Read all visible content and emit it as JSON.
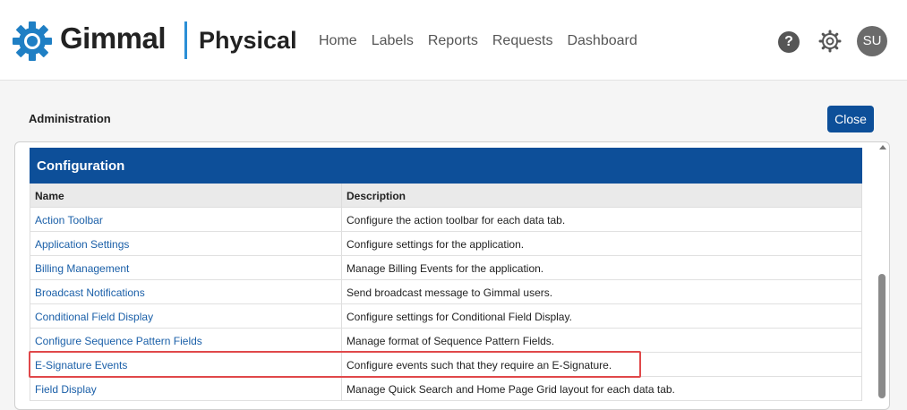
{
  "brand": {
    "name": "Gimmal",
    "product": "Physical"
  },
  "nav": [
    "Home",
    "Labels",
    "Reports",
    "Requests",
    "Dashboard"
  ],
  "header_icons": {
    "help": "?",
    "avatar": "SU"
  },
  "page": {
    "title": "Administration",
    "close_label": "Close"
  },
  "section": {
    "title": "Configuration"
  },
  "table": {
    "columns": [
      "Name",
      "Description"
    ],
    "rows": [
      {
        "name": "Action Toolbar",
        "description": "Configure the action toolbar for each data tab."
      },
      {
        "name": "Application Settings",
        "description": "Configure settings for the application."
      },
      {
        "name": "Billing Management",
        "description": "Manage Billing Events for the application."
      },
      {
        "name": "Broadcast Notifications",
        "description": "Send broadcast message to Gimmal users."
      },
      {
        "name": "Conditional Field Display",
        "description": "Configure settings for Conditional Field Display."
      },
      {
        "name": "Configure Sequence Pattern Fields",
        "description": "Manage format of Sequence Pattern Fields."
      },
      {
        "name": "E-Signature Events",
        "description": "Configure events such that they require an E-Signature."
      },
      {
        "name": "Field Display",
        "description": "Manage Quick Search and Home Page Grid layout for each data tab."
      }
    ]
  },
  "colors": {
    "primary": "#0d4f99",
    "link": "#1a5fa8",
    "accent": "#2b8fd6",
    "highlight": "#e0484a"
  },
  "icons": {
    "logo": "gear-logo-icon",
    "help": "help-icon",
    "settings": "gear-icon",
    "scroll": "scroll-up-icon"
  }
}
